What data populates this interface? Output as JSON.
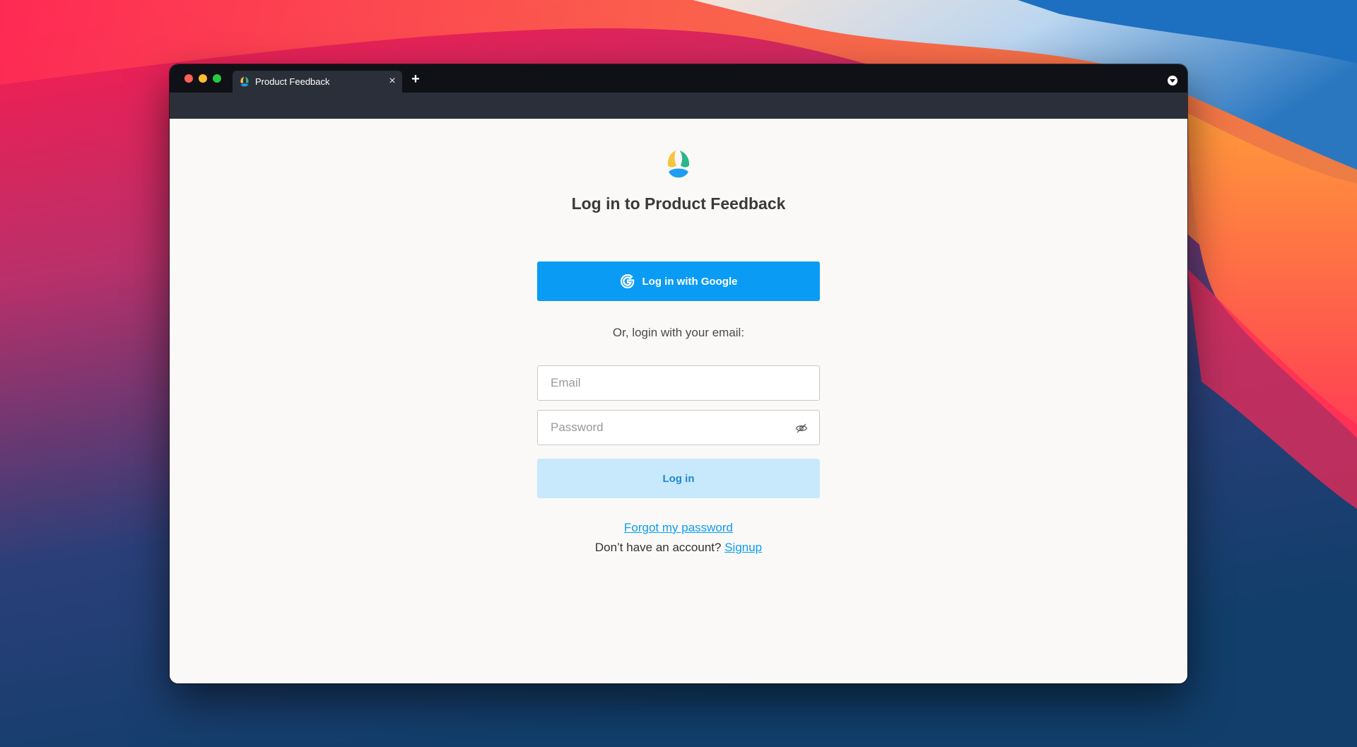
{
  "browser": {
    "tab_title": "Product Feedback",
    "tab_close_icon": "close-icon",
    "new_tab_icon": "plus-icon",
    "menu_icon": "chevron-down-circle-icon"
  },
  "login": {
    "title": "Log in to Product Feedback",
    "google_button_label": "Log in with Google",
    "or_text": "Or, login with your email:",
    "email_placeholder": "Email",
    "password_placeholder": "Password",
    "login_button_label": "Log in",
    "forgot_password_link": "Forgot my password",
    "no_account_text": "Don’t have an account?",
    "signup_link": "Signup"
  },
  "colors": {
    "primary": "#0a9cf5",
    "login_button_bg": "#c8e8fc",
    "logo_yellow": "#f5c542",
    "logo_green": "#2bb58a",
    "logo_blue": "#1e9ef0"
  }
}
